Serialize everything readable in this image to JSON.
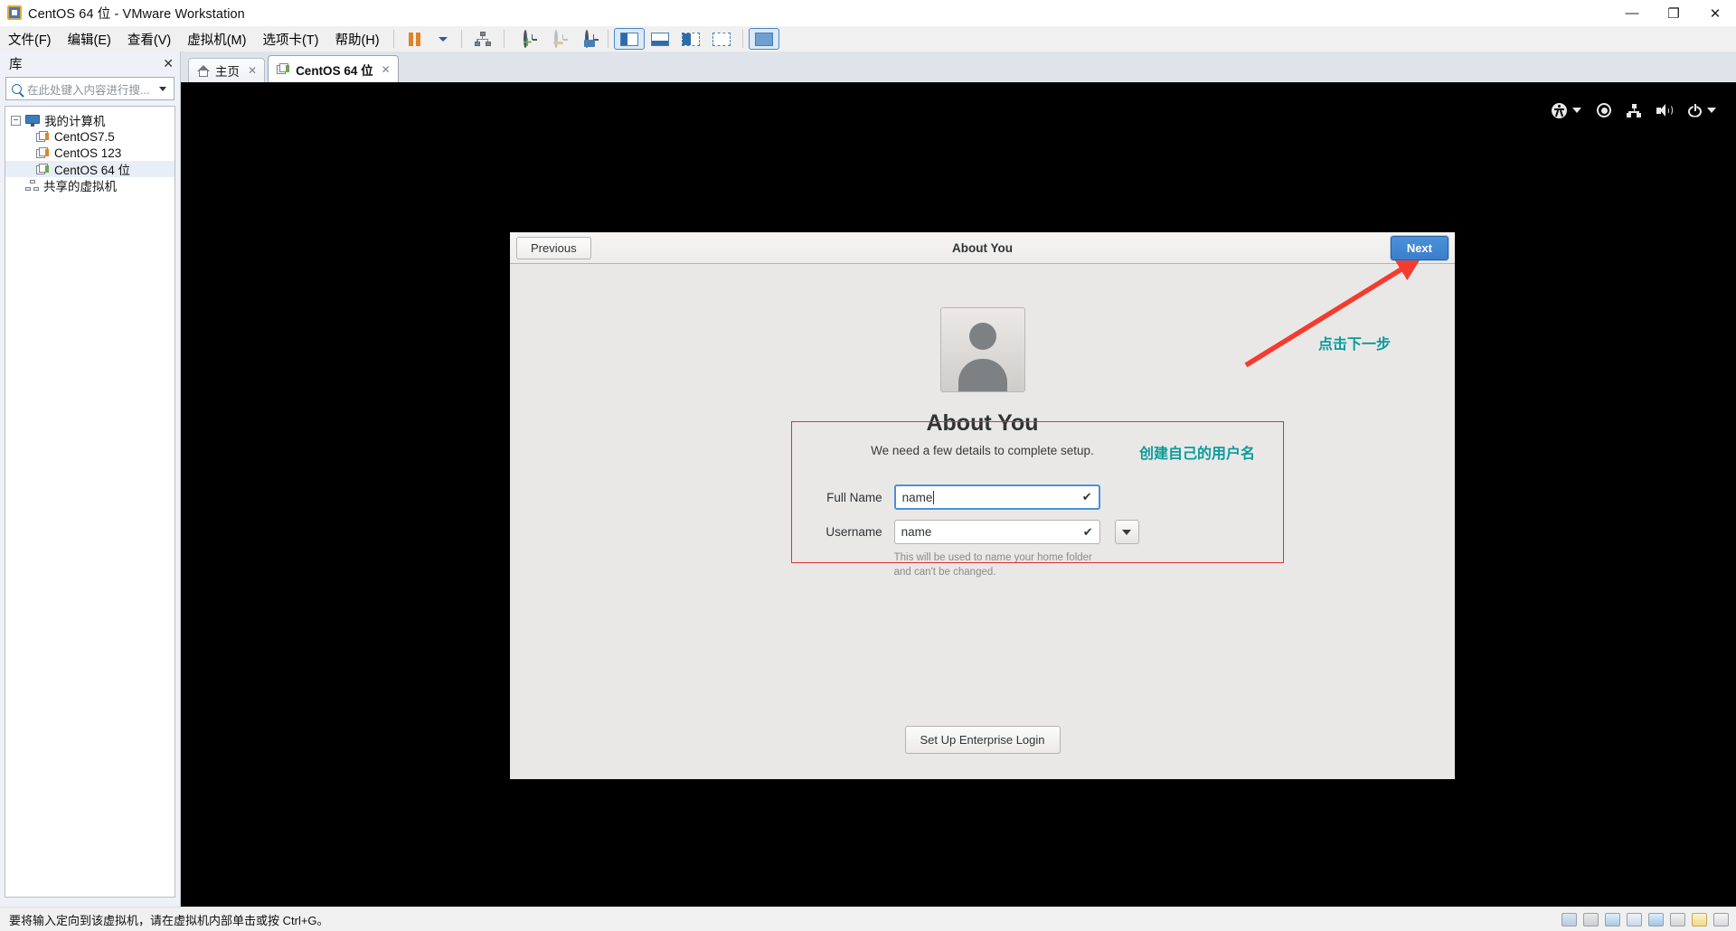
{
  "window": {
    "title": "CentOS 64 位 - VMware Workstation",
    "app_icon": "vmware-logo-icon",
    "controls": {
      "minimize": "—",
      "maximize": "❐",
      "close": "✕"
    }
  },
  "menubar": {
    "items": [
      {
        "label": "文件(F)",
        "key": "F"
      },
      {
        "label": "编辑(E)",
        "key": "E"
      },
      {
        "label": "查看(V)",
        "key": "V"
      },
      {
        "label": "虚拟机(M)",
        "key": "M"
      },
      {
        "label": "选项卡(T)",
        "key": "T"
      },
      {
        "label": "帮助(H)",
        "key": "H"
      }
    ]
  },
  "toolbar": {
    "buttons": [
      {
        "name": "suspend-button",
        "icon": "pause-icon"
      },
      {
        "name": "power-dropdown",
        "icon": "chevron-down-icon"
      },
      {
        "name": "manage-button",
        "icon": "network-manage-icon"
      },
      {
        "name": "take-snapshot-button",
        "icon": "snapshot-add-icon"
      },
      {
        "name": "revert-snapshot-button",
        "icon": "snapshot-revert-icon"
      },
      {
        "name": "snapshot-manager-button",
        "icon": "snapshot-manager-icon"
      },
      {
        "name": "show-library-button",
        "icon": "left-pane-icon"
      },
      {
        "name": "show-thumbnail-bar-button",
        "icon": "bottom-pane-icon"
      },
      {
        "name": "show-console-view-button",
        "icon": "split-pane-icon"
      },
      {
        "name": "show-full-screen-button",
        "icon": "fullscreen-pane-icon"
      },
      {
        "name": "unity-mode-button",
        "icon": "unity-icon"
      }
    ]
  },
  "library": {
    "header": "库",
    "close_label": "✕",
    "search_placeholder": "在此处键入内容进行搜...",
    "search_value": "",
    "search_icon": "search-icon",
    "tree": [
      {
        "label": "我的计算机",
        "icon": "my-computer-icon",
        "level": 0,
        "expander": "−",
        "selected": false
      },
      {
        "label": "CentOS7.5",
        "icon": "vm-icon",
        "level": 1,
        "selected": false
      },
      {
        "label": "CentOS 123",
        "icon": "vm-icon",
        "level": 1,
        "selected": false
      },
      {
        "label": "CentOS 64 位",
        "icon": "vm-icon-running",
        "level": 1,
        "selected": true
      },
      {
        "label": "共享的虚拟机",
        "icon": "shared-vms-icon",
        "level": 0,
        "selected": false
      }
    ]
  },
  "tabs": [
    {
      "label": "主页",
      "icon": "home-icon",
      "active": false,
      "close": "✕"
    },
    {
      "label": "CentOS 64 位",
      "icon": "vm-icon",
      "active": true,
      "close": "✕"
    }
  ],
  "guest": {
    "topbar_icons": [
      {
        "name": "accessibility-icon",
        "glyph": "a11y"
      },
      {
        "name": "accessibility-dropdown-icon",
        "glyph": "caret"
      },
      {
        "name": "screen-record-icon",
        "glyph": "record"
      },
      {
        "name": "network-icon",
        "glyph": "network"
      },
      {
        "name": "volume-icon",
        "glyph": "volume"
      },
      {
        "name": "power-icon",
        "glyph": "power"
      },
      {
        "name": "system-menu-dropdown-icon",
        "glyph": "caret"
      }
    ],
    "setup": {
      "previous_label": "Previous",
      "header_title": "About You",
      "next_label": "Next",
      "avatar_icon": "user-avatar-icon",
      "heading": "About You",
      "subheading": "We need a few details to complete setup.",
      "fields": [
        {
          "label": "Full Name",
          "value": "name",
          "focused": true,
          "valid_icon": "check-icon",
          "has_dropdown": false
        },
        {
          "label": "Username",
          "value": "name",
          "focused": false,
          "valid_icon": "check-icon",
          "has_dropdown": true,
          "dropdown_icon": "chevron-down-icon"
        }
      ],
      "hint": "This will be used to name your home folder and can't be changed.",
      "enterprise_label": "Set Up Enterprise Login"
    }
  },
  "annotations": {
    "next_note": "点击下一步",
    "username_note": "创建自己的用户名",
    "arrow_color": "#f43c2e",
    "box_color": "#e03030",
    "text_color": "#0b9b9b"
  },
  "statusbar": {
    "message": "要将输入定向到该虚拟机，请在虚拟机内部单击或按 Ctrl+G。",
    "tray_icons": [
      "hard-disk-icon",
      "cd-dvd-icon",
      "floppy-icon",
      "network-adapter-icon",
      "usb-icon",
      "sound-card-icon",
      "printer-icon",
      "display-icon"
    ]
  }
}
